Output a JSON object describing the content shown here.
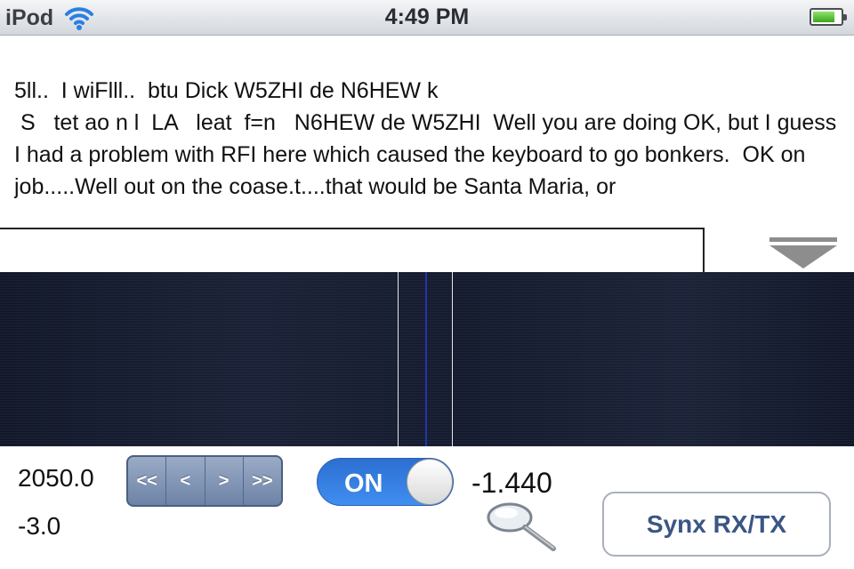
{
  "status_bar": {
    "carrier": "iPod",
    "time": "4:49 PM",
    "wifi_icon": "wifi-icon",
    "battery_icon": "battery-icon"
  },
  "decoded_text": "5ll..  I wiFlll..  btu Dick W5ZHI de N6HEW k\n S   tet ao n l  LA   leat  f=n   N6HEW de W5ZHI  Well you are doing OK, but I guess I had a problem with RFI here which caused the keyboard to go bonkers.  OK on job.....Well out on the coase.t....that would be Santa Maria, or",
  "entry_field": {
    "value": ""
  },
  "controls": {
    "frequency": "2050.0",
    "offset": "-3.0",
    "reading": "-1.440",
    "tune_buttons": [
      "<<",
      "<",
      ">",
      ">>"
    ],
    "toggle_label": "ON",
    "toggle_state": "on",
    "sync_button": "Synx RX/TX",
    "zoom_icon": "magnifier-icon",
    "collapse_icon": "double-down-arrow-icon"
  },
  "colors": {
    "waterfall_background": "#161c30",
    "center_marker": "#2433a8",
    "toggle_on": "#2f78dc",
    "button_text": "#3a5684"
  }
}
